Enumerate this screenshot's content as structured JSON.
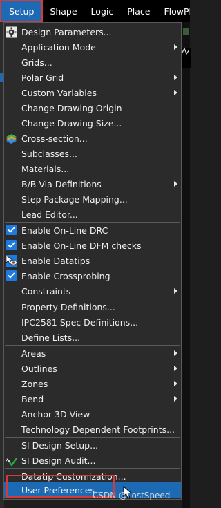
{
  "menubar": {
    "items": [
      "Setup",
      "Shape",
      "Logic",
      "Place",
      "FlowPlan"
    ]
  },
  "setup_menu": {
    "items": [
      {
        "label": "Design Parameters...",
        "icon": "design-parameters-gear-icon"
      },
      {
        "label": "Application Mode",
        "submenu": true
      },
      {
        "label": "Grids..."
      },
      {
        "label": "Polar Grid",
        "submenu": true
      },
      {
        "label": "Custom Variables",
        "submenu": true
      },
      {
        "label": "Change Drawing Origin"
      },
      {
        "label": "Change Drawing Size..."
      },
      {
        "label": "Cross-section...",
        "icon": "cross-section-layers-icon"
      },
      {
        "label": "Subclasses..."
      },
      {
        "label": "Materials..."
      },
      {
        "label": "B/B Via Definitions",
        "submenu": true
      },
      {
        "label": "Step Package Mapping..."
      },
      {
        "label": "Lead Editor..."
      },
      {
        "label": "Enable On-Line DRC",
        "checked": true
      },
      {
        "label": "Enable On-Line DFM checks",
        "checked": true
      },
      {
        "label": "Enable Datatips",
        "icon": "datatip-eye-icon"
      },
      {
        "label": "Enable Crossprobing",
        "checked": true
      },
      {
        "label": "Constraints",
        "submenu": true
      },
      {
        "label": "Property Definitions..."
      },
      {
        "label": "IPC2581 Spec Definitions..."
      },
      {
        "label": "Define Lists..."
      },
      {
        "label": "Areas",
        "submenu": true
      },
      {
        "label": "Outlines",
        "submenu": true
      },
      {
        "label": "Zones",
        "submenu": true
      },
      {
        "label": "Bend",
        "submenu": true
      },
      {
        "label": "Anchor 3D View"
      },
      {
        "label": "Technology Dependent Footprints..."
      },
      {
        "label": "SI Design Setup..."
      },
      {
        "label": "SI Design Audit...",
        "icon": "si-audit-check-icon"
      },
      {
        "label": "Datatip Customization..."
      },
      {
        "label": "User Preferences...",
        "highlighted": true
      }
    ]
  },
  "watermark": "CSDN @LostSpeed",
  "colors": {
    "menu_bg": "#2b2b2b",
    "highlight": "#1c69b4",
    "annotation_red": "#d23b3b",
    "check_blue": "#1c7ae0"
  }
}
